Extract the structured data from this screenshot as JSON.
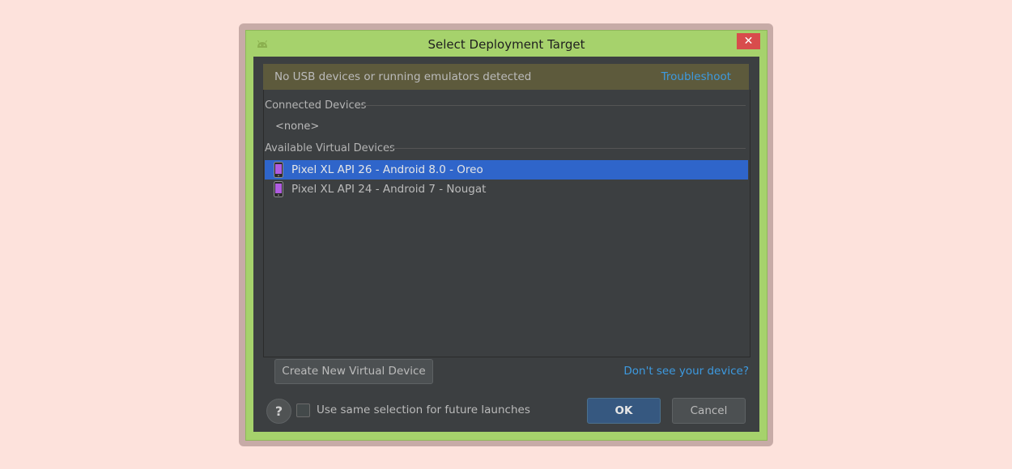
{
  "dialog": {
    "title": "Select Deployment Target",
    "close_symbol": "✕"
  },
  "banner": {
    "message": "No USB devices or running emulators detected",
    "link": "Troubleshoot"
  },
  "connected": {
    "header": "Connected Devices",
    "empty_text": "<none>"
  },
  "virtual": {
    "header": "Available Virtual Devices",
    "devices": [
      {
        "label": "Pixel XL API 26 - Android 8.0 - Oreo",
        "selected": true
      },
      {
        "label": "Pixel XL API 24 - Android 7 - Nougat",
        "selected": false
      }
    ]
  },
  "actions": {
    "create_label": "Create New Virtual Device",
    "dont_see_link": "Don't see your device?",
    "help_symbol": "?",
    "checkbox_label": "Use same selection for future launches",
    "checkbox_checked": false,
    "ok_label": "OK",
    "cancel_label": "Cancel"
  },
  "colors": {
    "page_bg": "#fde2dc",
    "window_frame": "#a6d26c",
    "content_bg": "#3c3f41",
    "banner_bg": "#5d5a3c",
    "link": "#3d9ae0",
    "selection": "#2f65ca",
    "ok_button": "#365880",
    "close_button": "#d84c4c"
  },
  "icons": {
    "app": "android-icon",
    "device": "phone-icon",
    "close": "close-icon",
    "help": "help-icon"
  }
}
